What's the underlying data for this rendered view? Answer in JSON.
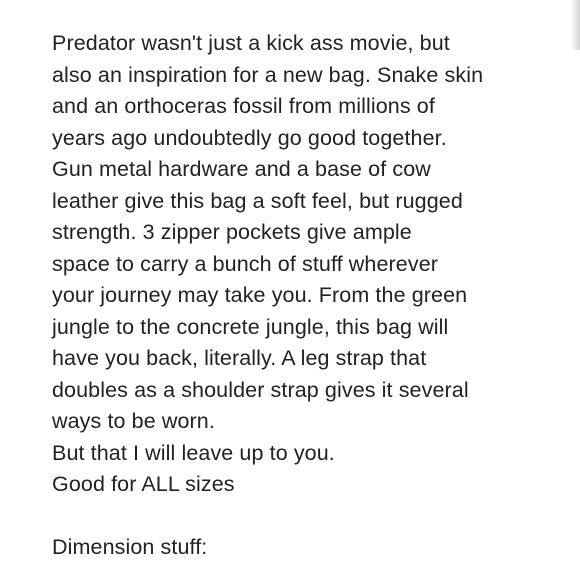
{
  "description": {
    "lines": [
      "Predator wasn't just a kick ass movie, but",
      "also an inspiration for a new bag. Snake skin",
      "and an orthoceras fossil from millions of",
      "years ago undoubtedly go good together.",
      "Gun metal hardware and a base of cow",
      "leather give this bag a soft feel, but rugged",
      "strength.  3 zipper pockets give ample",
      "space to carry a bunch of stuff wherever",
      "your journey may take you.  From the green",
      "jungle to the concrete jungle, this bag will",
      "have you back, literally.  A leg strap that",
      "doubles as a shoulder strap gives it several",
      "ways to be worn.",
      "But that I will leave up to you.",
      "Good for ALL sizes",
      "",
      "Dimension stuff:"
    ]
  },
  "colors": {
    "text": "#222222",
    "background": "#ffffff"
  }
}
